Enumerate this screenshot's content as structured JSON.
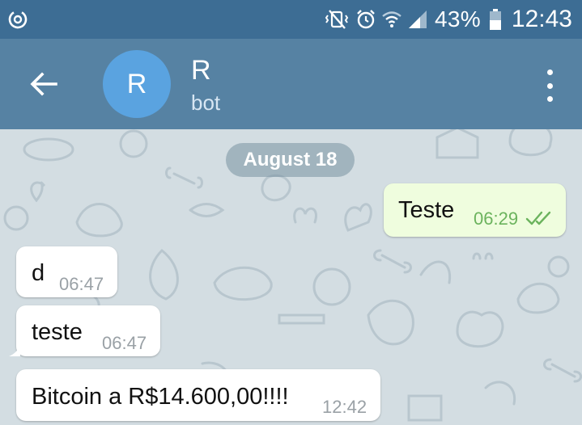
{
  "status_bar": {
    "battery_text": "43%",
    "time": "12:43",
    "icons": [
      "data-saver-icon",
      "mute-vibrate-icon",
      "alarm-icon",
      "wifi-icon",
      "signal-icon",
      "battery-icon"
    ]
  },
  "app_bar": {
    "avatar_initial": "R",
    "title": "R",
    "subtitle": "bot",
    "icons": [
      "back-arrow-icon",
      "more-vert-icon"
    ]
  },
  "chat": {
    "date_label": "August 18",
    "messages": [
      {
        "direction": "outgoing",
        "text": "Teste",
        "time": "06:29",
        "status": "read"
      },
      {
        "direction": "incoming",
        "text": "d",
        "time": "06:47"
      },
      {
        "direction": "incoming",
        "text": "teste",
        "time": "06:47"
      },
      {
        "direction": "incoming",
        "text": "Bitcoin a R$14.600,00!!!!",
        "time": "12:42"
      }
    ]
  },
  "colors": {
    "status_bar": "#3d6d94",
    "app_bar": "#5682a3",
    "avatar": "#5aa3e0",
    "chat_background": "#d3dde2",
    "outgoing_bubble": "#effdde",
    "incoming_bubble": "#ffffff",
    "read_check": "#6bb35d"
  }
}
